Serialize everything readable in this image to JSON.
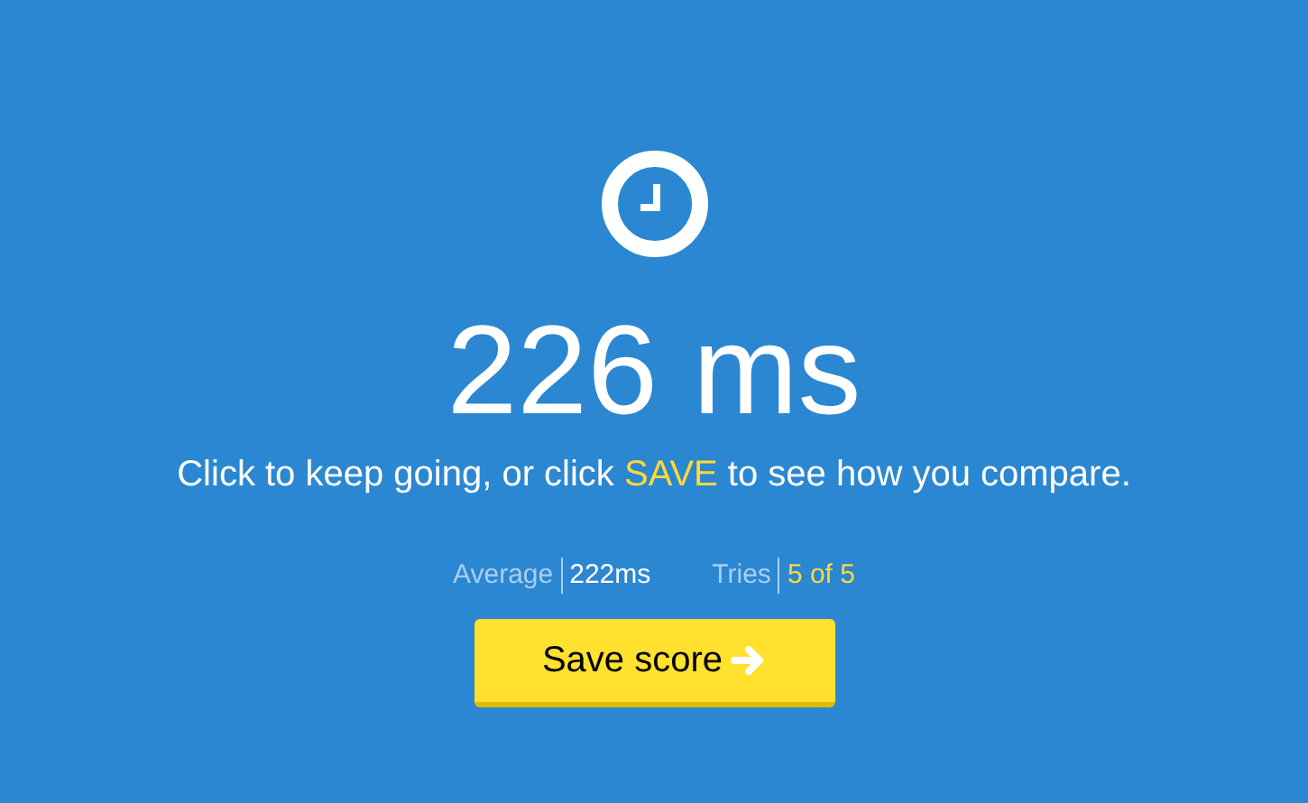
{
  "result": "226 ms",
  "message": {
    "before": "Click to keep going, or click ",
    "highlight": "SAVE",
    "after": " to see how you compare."
  },
  "stats": [
    {
      "label": "Average",
      "value": "222ms",
      "kind": "plain"
    },
    {
      "label": "Tries",
      "value": "5 of 5",
      "kind": "accent"
    }
  ],
  "button": "Save score"
}
